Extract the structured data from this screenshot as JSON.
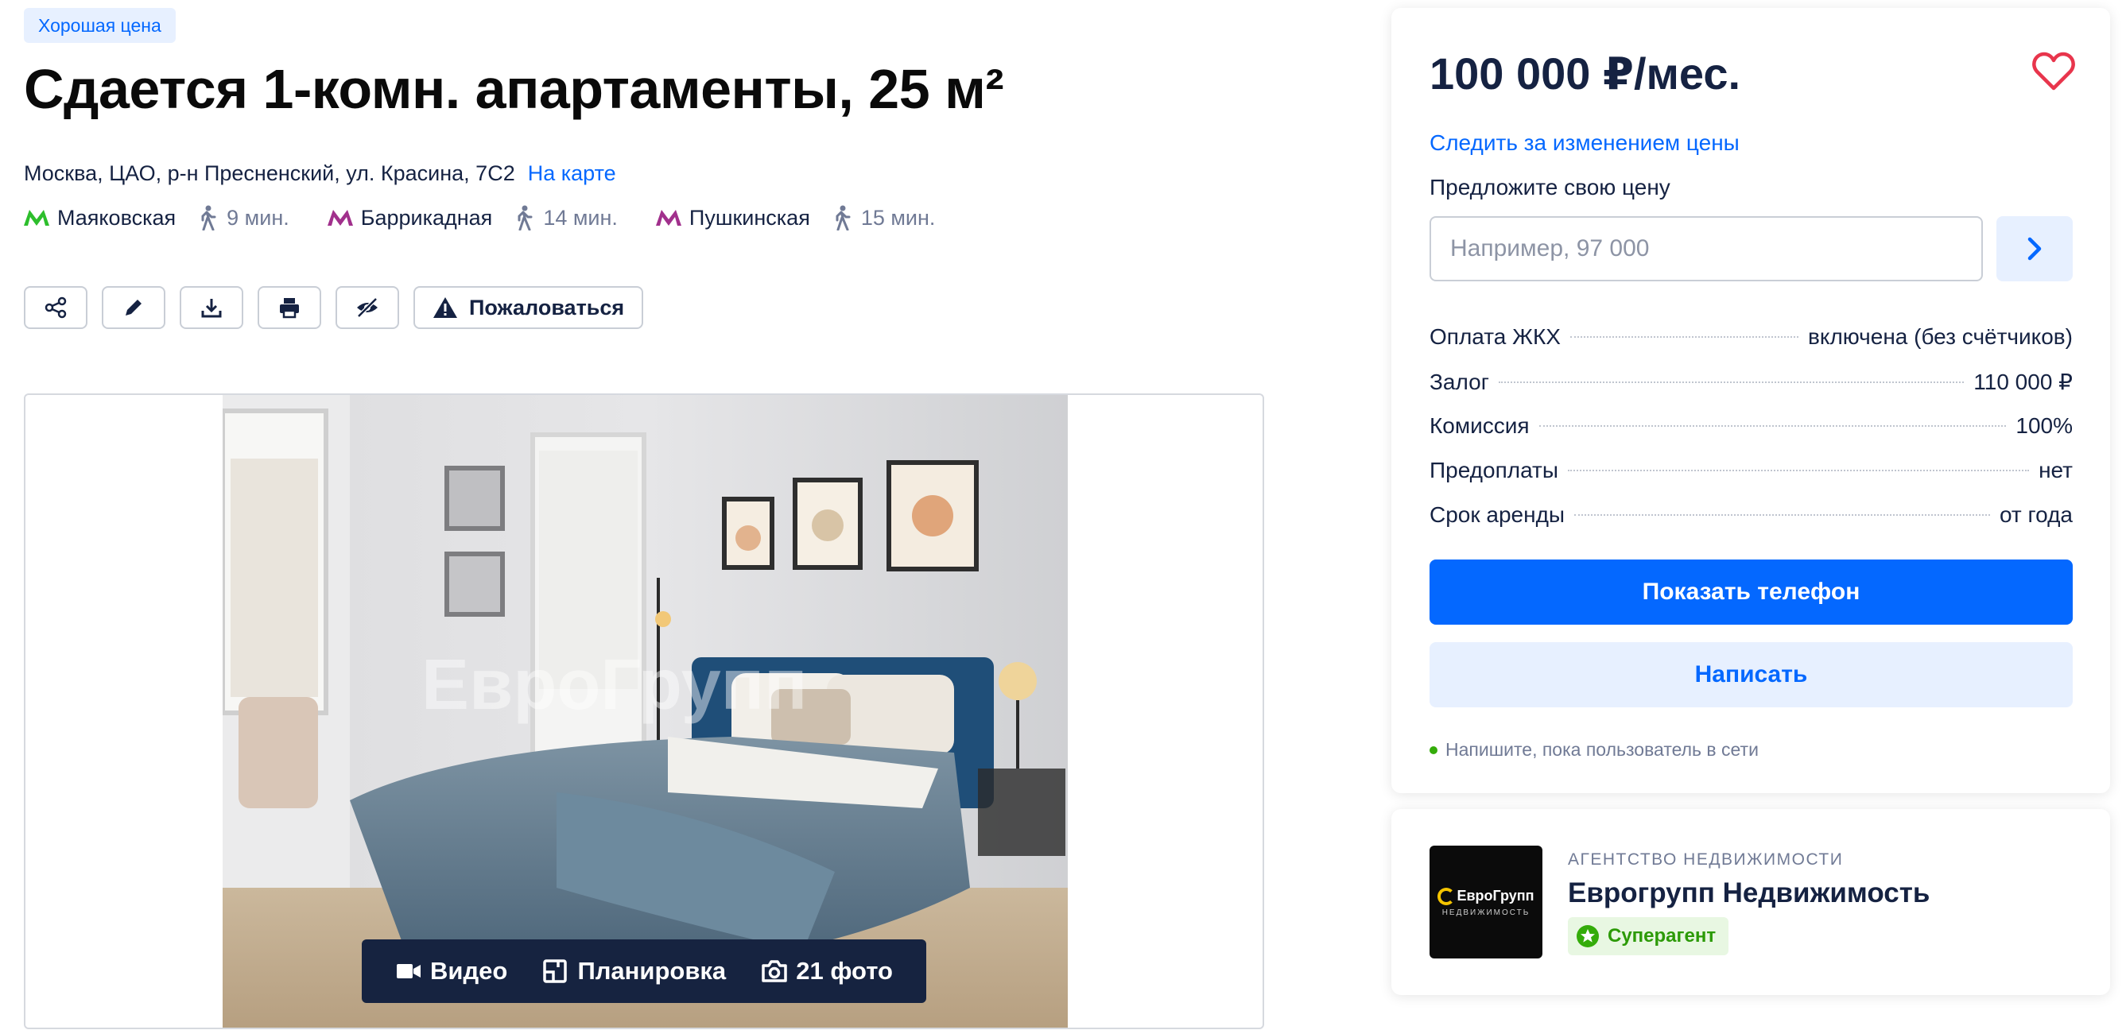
{
  "badge": "Хорошая цена",
  "title": "Сдается 1-комн. апартаменты, 25 м²",
  "address": {
    "text": "Москва, ЦАО, р-н Пресненский, ул. Красина, 7С2",
    "map_link": "На карте"
  },
  "metro": [
    {
      "name": "Маяковская",
      "time": "9 мин.",
      "color": "#2dbe2c"
    },
    {
      "name": "Баррикадная",
      "time": "14 мин.",
      "color": "#a1308c"
    },
    {
      "name": "Пушкинская",
      "time": "15 мин.",
      "color": "#a1308c"
    }
  ],
  "toolbar": {
    "report_label": "Пожаловаться",
    "icons": [
      "share-icon",
      "pencil-icon",
      "download-icon",
      "print-icon",
      "hide-icon"
    ]
  },
  "gallery": {
    "video_label": "Видео",
    "plan_label": "Планировка",
    "photos_label": "21 фото",
    "watermark": "ЕвроГрупп"
  },
  "offer": {
    "price": "100 000 ₽/мес.",
    "watch_price": "Следить за изменением цены",
    "suggest_label": "Предложите свою цену",
    "input_placeholder": "Например, 97 000",
    "input_value": ""
  },
  "terms": [
    {
      "label": "Оплата ЖКХ",
      "value": "включена (без счётчиков)"
    },
    {
      "label": "Залог",
      "value": "110 000 ₽"
    },
    {
      "label": "Комиссия",
      "value": "100%"
    },
    {
      "label": "Предоплаты",
      "value": "нет"
    },
    {
      "label": "Срок аренды",
      "value": "от года"
    }
  ],
  "actions": {
    "show_phone": "Показать телефон",
    "write": "Написать",
    "online_hint": "Напишите, пока пользователь в сети"
  },
  "agent": {
    "type": "АГЕНТСТВО НЕДВИЖИМОСТИ",
    "name": "Еврогрупп Недвижимость",
    "badge": "Суперагент",
    "logo_text": "ЕвроГрупп",
    "logo_sub": "НЕДВИЖИМОСТЬ"
  },
  "colors": {
    "accent": "#0468ff",
    "accent_light": "#e7f0ff",
    "text_dark": "#152242",
    "muted": "#707a95",
    "online": "#34ac0a"
  }
}
